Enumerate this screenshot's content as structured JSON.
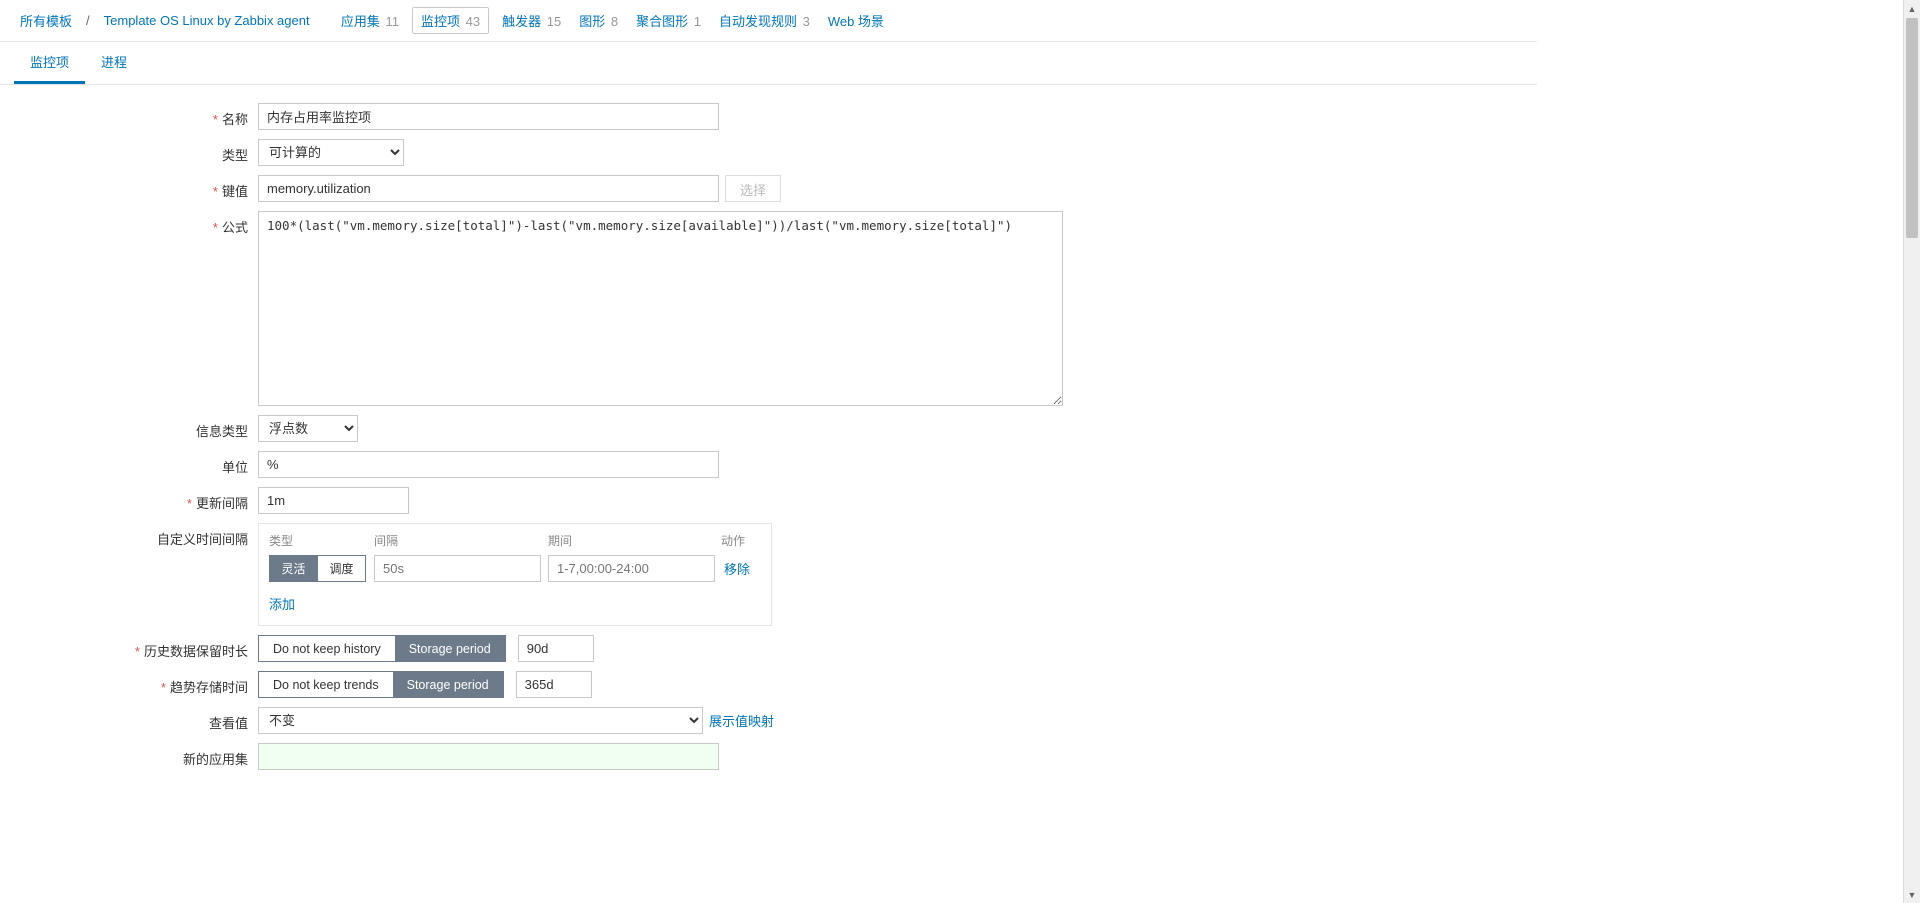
{
  "breadcrumb": {
    "all_templates": "所有模板",
    "template_name": "Template OS Linux by Zabbix agent",
    "items": [
      {
        "label": "应用集",
        "count": "11"
      },
      {
        "label": "监控项",
        "count": "43"
      },
      {
        "label": "触发器",
        "count": "15"
      },
      {
        "label": "图形",
        "count": "8"
      },
      {
        "label": "聚合图形",
        "count": "1"
      },
      {
        "label": "自动发现规则",
        "count": "3"
      },
      {
        "label": "Web 场景",
        "count": ""
      }
    ]
  },
  "tabs": {
    "item": "监控项",
    "process": "进程"
  },
  "labels": {
    "name": "名称",
    "type": "类型",
    "key": "键值",
    "formula": "公式",
    "info_type": "信息类型",
    "units": "单位",
    "update_interval": "更新间隔",
    "custom_intervals": "自定义时间间隔",
    "ci_type": "类型",
    "ci_interval": "间隔",
    "ci_period": "期间",
    "ci_action": "动作",
    "history": "历史数据保留时长",
    "trends": "趋势存储时间",
    "show_value": "查看值",
    "new_app": "新的应用集"
  },
  "values": {
    "name": "内存占用率监控项",
    "type_selected": "可计算的",
    "key": "memory.utilization",
    "select_btn": "选择",
    "formula": "100*(last(\"vm.memory.size[total]\")-last(\"vm.memory.size[available]\"))/last(\"vm.memory.size[total]\")",
    "info_type_selected": "浮点数",
    "units": "%",
    "update_interval": "1m",
    "ci_flexible": "灵活",
    "ci_scheduling": "调度",
    "ci_interval_ph": "50s",
    "ci_period_ph": "1-7,00:00-24:00",
    "ci_remove": "移除",
    "ci_add": "添加",
    "history_no_keep": "Do not keep history",
    "history_storage": "Storage period",
    "history_val": "90d",
    "trends_no_keep": "Do not keep trends",
    "trends_storage": "Storage period",
    "trends_val": "365d",
    "show_value_selected": "不变",
    "show_value_mappings": "展示值映射"
  }
}
